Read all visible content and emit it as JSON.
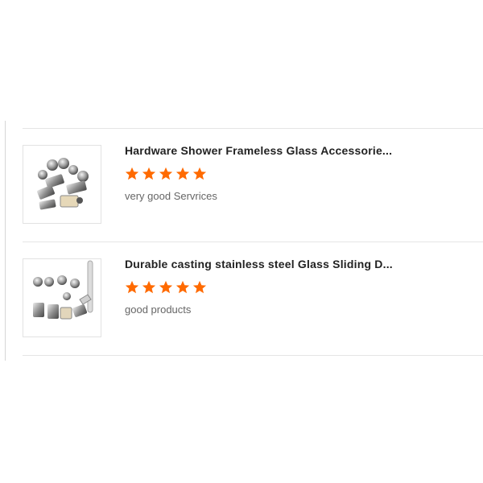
{
  "reviews": [
    {
      "product_title": "Hardware Shower Frameless Glass Accessorie...",
      "rating": 5,
      "rating_max": 5,
      "comment": "very good Servrices",
      "thumbnail_icon": "shower-glass-hardware-set-image"
    },
    {
      "product_title": "Durable casting stainless steel Glass Sliding D...",
      "rating": 5,
      "rating_max": 5,
      "comment": "good products",
      "thumbnail_icon": "sliding-door-hardware-kit-image"
    }
  ],
  "colors": {
    "star": "#ff6a00",
    "divider": "#e5e5e5",
    "title": "#222222",
    "comment": "#666666"
  }
}
